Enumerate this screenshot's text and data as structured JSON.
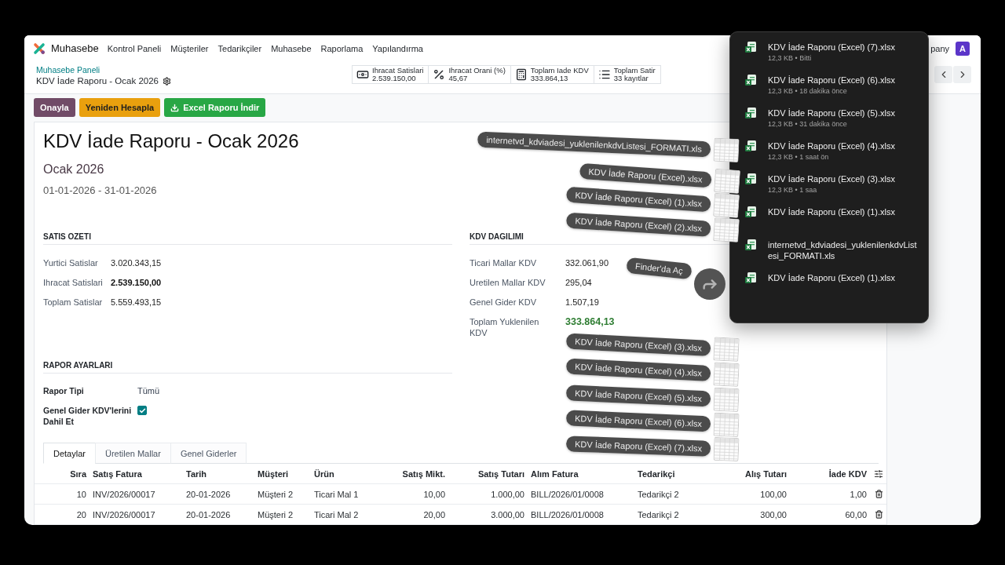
{
  "navbar": {
    "app_name": "Muhasebe",
    "menu": [
      "Kontrol Paneli",
      "Müşteriler",
      "Tedarikçiler",
      "Muhasebe",
      "Raporlama",
      "Yapılandırma"
    ],
    "company": "pany",
    "avatar": "A"
  },
  "breadcrumb": {
    "parent": "Muhasebe Paneli",
    "current": "KDV İade Raporu - Ocak 2026"
  },
  "stat_buttons": [
    {
      "kind": "money",
      "label": "Ihracat Satislari",
      "value": "2.539.150,00"
    },
    {
      "kind": "percent",
      "label": "Ihracat Orani (%)",
      "value": "45,67"
    },
    {
      "kind": "calculator",
      "label": "Toplam Iade KDV",
      "value": "333.864,13"
    },
    {
      "kind": "list",
      "label": "Toplam Satir",
      "value": "33 kayıtlar"
    }
  ],
  "actions": [
    {
      "kind": "primary",
      "label": "Onayla"
    },
    {
      "kind": "warning",
      "label": "Yeniden Hesapla"
    },
    {
      "kind": "download",
      "label": "Excel Raporu İndir"
    }
  ],
  "form": {
    "title": "KDV İade Raporu - Ocak 2026",
    "period": "Ocak 2026",
    "date_range": "01-01-2026 - 31-01-2026",
    "sections": [
      {
        "title": "SATIS OZETI",
        "rows": [
          {
            "kind": "plain",
            "label": "Yurtici Satislar",
            "value": "3.020.343,15"
          },
          {
            "kind": "bold",
            "label": "Ihracat Satislari",
            "value": "2.539.150,00"
          },
          {
            "kind": "plain",
            "label": "Toplam Satislar",
            "value": "5.559.493,15"
          }
        ]
      },
      {
        "title": "KDV DAGILIMI",
        "rows": [
          {
            "kind": "plain",
            "label": "Ticari Mallar KDV",
            "value": "332.061,90"
          },
          {
            "kind": "plain",
            "label": "Uretilen Mallar KDV",
            "value": "295,04"
          },
          {
            "kind": "plain",
            "label": "Genel Gider KDV",
            "value": "1.507,19"
          },
          {
            "kind": "total",
            "label": "Toplam Yuklenilen KDV",
            "value": "333.864,13"
          }
        ]
      }
    ],
    "settings": {
      "title": "RAPOR AYARLARI",
      "fields": [
        {
          "kind": "text",
          "label": "Rapor Tipi",
          "value": "Tümü"
        },
        {
          "kind": "checkbox",
          "label": "Genel Gider KDV'lerini Dahil Et",
          "checked": true
        }
      ]
    }
  },
  "tabs": [
    {
      "label": "Detaylar",
      "selected": true
    },
    {
      "label": "Üretilen Mallar",
      "selected": false
    },
    {
      "label": "Genel Giderler",
      "selected": false
    }
  ],
  "table": {
    "columns": [
      "Sıra",
      "Satış Fatura",
      "Tarih",
      "Müşteri",
      "Ürün",
      "Satış Mikt.",
      "Satış Tutarı",
      "Alım Fatura",
      "Tedarikçi",
      "Alış Tutarı",
      "İade KDV"
    ],
    "rows": [
      {
        "cells": [
          "10",
          "INV/2026/00017",
          "20-01-2026",
          "Müşteri 2",
          "Ticari Mal 1",
          "10,00",
          "1.000,00",
          "BILL/2026/01/0008",
          "Tedarikçi 2",
          "100,00",
          "1,00"
        ]
      },
      {
        "cells": [
          "20",
          "INV/2026/00017",
          "20-01-2026",
          "Müşteri 2",
          "Ticari Mal 2",
          "20,00",
          "3.000,00",
          "BILL/2026/01/0008",
          "Tedarikçi 2",
          "300,00",
          "60,00"
        ]
      }
    ]
  },
  "downloads": {
    "items": [
      {
        "name": "KDV İade Raporu (Excel) (7).xlsx",
        "meta": "12,3 KB • Bitti"
      },
      {
        "name": "KDV İade Raporu (Excel) (6).xlsx",
        "meta": "12,3 KB • 18 dakika önce"
      },
      {
        "name": "KDV İade Raporu (Excel) (5).xlsx",
        "meta": "12,3 KB • 31 dakika önce"
      },
      {
        "name": "KDV İade Raporu (Excel) (4).xlsx",
        "meta": "12,3 KB • 1 saat ön"
      },
      {
        "name": "KDV İade Raporu (Excel) (3).xlsx",
        "meta": "12,3 KB • 1 saa"
      },
      {
        "name": "KDV İade Raporu (Excel) (1).xlsx"
      },
      {
        "name": "internetvd_kdviadesi_yuklenilenkdvListesi_FORMATI.xls"
      },
      {
        "name": "KDV İade Raporu (Excel) (1).xlsx"
      }
    ]
  },
  "drag": {
    "files": [
      "internetvd_kdviadesi_yuklenilenkdvListesi_FORMATI.xls",
      "KDV İade Raporu (Excel).xlsx",
      "KDV İade Raporu (Excel) (1).xlsx",
      "KDV İade Raporu (Excel) (2).xlsx",
      "KDV İade Raporu (Excel) (3).xlsx",
      "KDV İade Raporu (Excel) (4).xlsx",
      "KDV İade Raporu (Excel) (5).xlsx",
      "KDV İade Raporu (Excel) (6).xlsx",
      "KDV İade Raporu (Excel) (7).xlsx"
    ],
    "action": "Finder'da Aç"
  }
}
